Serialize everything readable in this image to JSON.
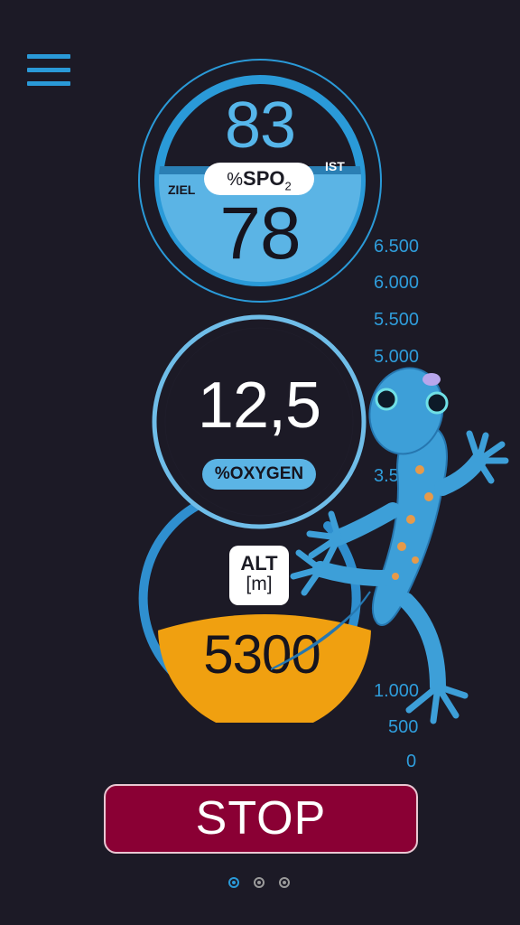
{
  "menu": {
    "icon": "hamburger-menu-icon"
  },
  "spo2": {
    "ist_value": "83",
    "ziel_value": "78",
    "pill_percent": "%",
    "pill_label": "SPO",
    "pill_sub": "2",
    "ziel_label": "ZIEL",
    "ist_label": "IST"
  },
  "altitude_scale": {
    "ticks": [
      "6.500",
      "6.000",
      "5.500",
      "5.000",
      "3.5",
      "1.000",
      "500",
      "0"
    ]
  },
  "oxygen": {
    "value": "12,5",
    "label": "%OXYGEN"
  },
  "altitude": {
    "value": "5300",
    "badge_line1": "ALT",
    "badge_line2": "[m]"
  },
  "stop": {
    "label": "STOP"
  },
  "pager": {
    "count": 3,
    "active_index": 0
  },
  "colors": {
    "background": "#1c1a26",
    "accent_blue": "#2a9ad8",
    "light_blue": "#5bb4e5",
    "altitude_orange": "#f0a010",
    "stop_red": "#8a0034"
  }
}
